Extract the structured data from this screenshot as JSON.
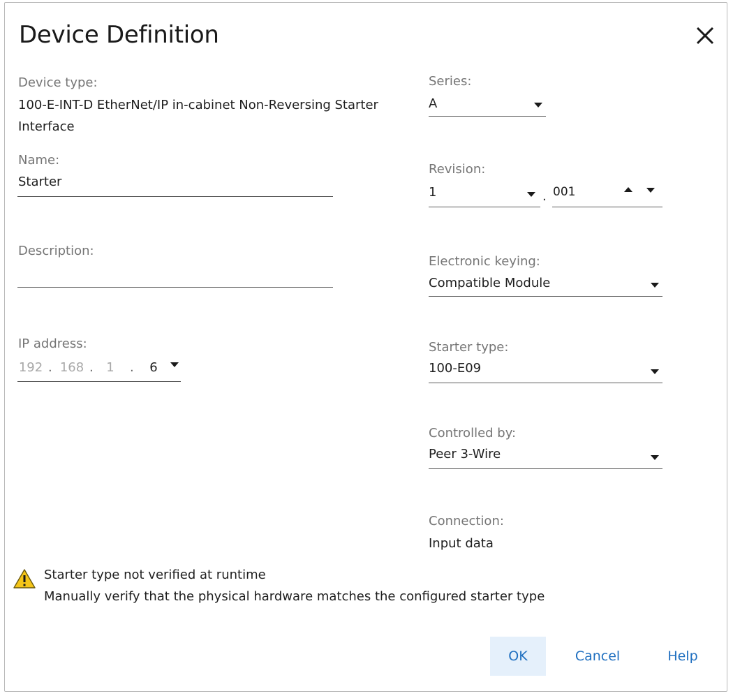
{
  "dialog": {
    "title": "Device Definition"
  },
  "device_type": {
    "label": "Device type:",
    "line1": "100-E-INT-D EtherNet/IP in-cabinet Non-Reversing Starter",
    "line2": "Interface"
  },
  "name": {
    "label": "Name:",
    "value": "Starter"
  },
  "description": {
    "label": "Description:",
    "value": ""
  },
  "ip_address": {
    "label": "IP address:",
    "segments": [
      "192",
      "168",
      "1",
      "6"
    ]
  },
  "series": {
    "label": "Series:",
    "value": "A"
  },
  "revision": {
    "label": "Revision:",
    "major": "1",
    "separator": ".",
    "minor": "001"
  },
  "electronic_keying": {
    "label": "Electronic keying:",
    "value": "Compatible Module"
  },
  "starter_type": {
    "label": "Starter type:",
    "value": "100-E09"
  },
  "controlled_by": {
    "label": "Controlled by:",
    "value": "Peer 3-Wire"
  },
  "connection": {
    "label": "Connection:",
    "value": "Input data"
  },
  "warning": {
    "title": "Starter type not verified at runtime",
    "message": "Manually verify that the physical hardware matches the configured starter type",
    "icon": "warning-triangle-icon",
    "color": "#f5c518"
  },
  "buttons": {
    "ok": "OK",
    "cancel": "Cancel",
    "help": "Help"
  },
  "colors": {
    "accent": "#1f6fc0",
    "primary_button_bg": "#e5f0fb"
  }
}
